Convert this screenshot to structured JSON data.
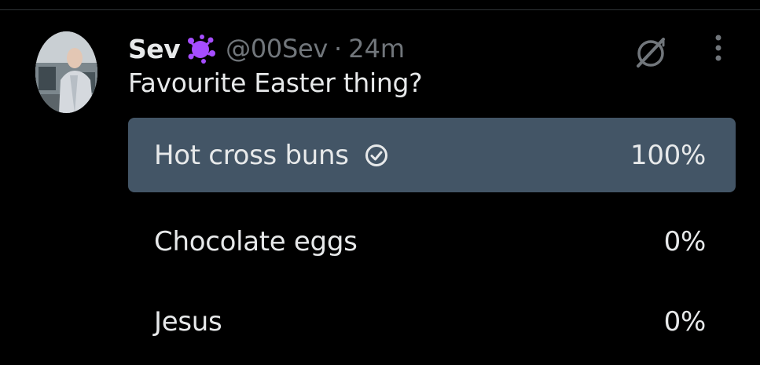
{
  "tweet": {
    "author_name": "Sev",
    "author_emoji": "purple-splat-emoji",
    "handle": "@00Sev",
    "separator": "·",
    "time": "24m",
    "text": "Favourite Easter thing?"
  },
  "icons": {
    "grok": "grok-icon",
    "more": "more-icon",
    "check": "check-circle-icon"
  },
  "colors": {
    "background": "#000000",
    "text_primary": "#e7e9ea",
    "text_secondary": "#71767b",
    "poll_bar": "#435566",
    "emoji_purple": "#a64dff"
  },
  "poll": {
    "options": [
      {
        "label": "Hot cross buns",
        "percent_text": "100%",
        "percent": 100,
        "selected": true
      },
      {
        "label": "Chocolate eggs",
        "percent_text": "0%",
        "percent": 0,
        "selected": false
      },
      {
        "label": "Jesus",
        "percent_text": "0%",
        "percent": 0,
        "selected": false
      }
    ]
  }
}
